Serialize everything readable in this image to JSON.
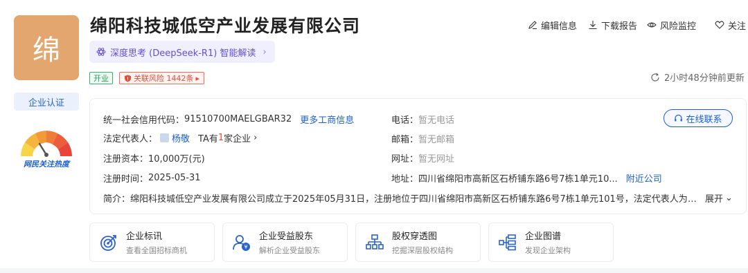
{
  "company": {
    "logo_char": "绵",
    "name": "绵阳科技城低空产业发展有限公司",
    "cert_label": "企业认证",
    "heat_label": "网民关注热度",
    "ai_banner": "深度思考 (DeepSeek-R1) 智能解读",
    "status_tag": "开业",
    "risk_tag": "关联风险 1442条"
  },
  "toolbar": {
    "edit": "编辑信息",
    "download": "下载报告",
    "monitor": "风险监控",
    "follow": "关注"
  },
  "update_time": "2小时48分钟前更新",
  "info": {
    "credit_label": "统一社会信用代码：",
    "credit_value": "91510700MAELGBAR32",
    "more_link": "更多工商信息",
    "legal_label": "法定代表人：",
    "legal_name": "杨敬",
    "legal_ta": "TA有",
    "legal_count": "1",
    "legal_suffix": "家企业",
    "capital_label": "注册资本：",
    "capital_value": "10,000万(元)",
    "date_label": "注册时间：",
    "date_value": "2025-05-31",
    "phone_label": "电话：",
    "phone_value": "暂无电话",
    "email_label": "邮箱：",
    "email_value": "暂无邮箱",
    "web_label": "网址：",
    "web_value": "暂无网址",
    "address_label": "地址：",
    "address_value": "四川省绵阳市高新区石桥铺东路6号7栋1单元10...",
    "nearby_link": "附近公司",
    "contact_button": "在线联系",
    "intro_label": "简介：",
    "intro_text": "绵阳科技城低空产业发展有限公司成立于2025年05月31日，注册地位于四川省绵阳市高新区石桥铺东路6号7栋1单元101号，法定代表人为杨...",
    "expand": "展开"
  },
  "cards": [
    {
      "title": "企业标讯",
      "subtitle": "查看全国招标商机",
      "icon": "target-icon"
    },
    {
      "title": "企业受益股东",
      "subtitle": "解析企业受益股东",
      "icon": "shareholder-icon"
    },
    {
      "title": "股权穿透图",
      "subtitle": "挖掘深层股权结构",
      "icon": "equity-tree-icon"
    },
    {
      "title": "企业图谱",
      "subtitle": "发现企业架构",
      "icon": "org-chart-icon"
    }
  ],
  "colors": {
    "accent": "#1b5fd0",
    "logo_bg": "#e3a66e",
    "ai_purple": "#6251d6",
    "open_green": "#2a9d5c",
    "risk_red": "#e84b36"
  }
}
